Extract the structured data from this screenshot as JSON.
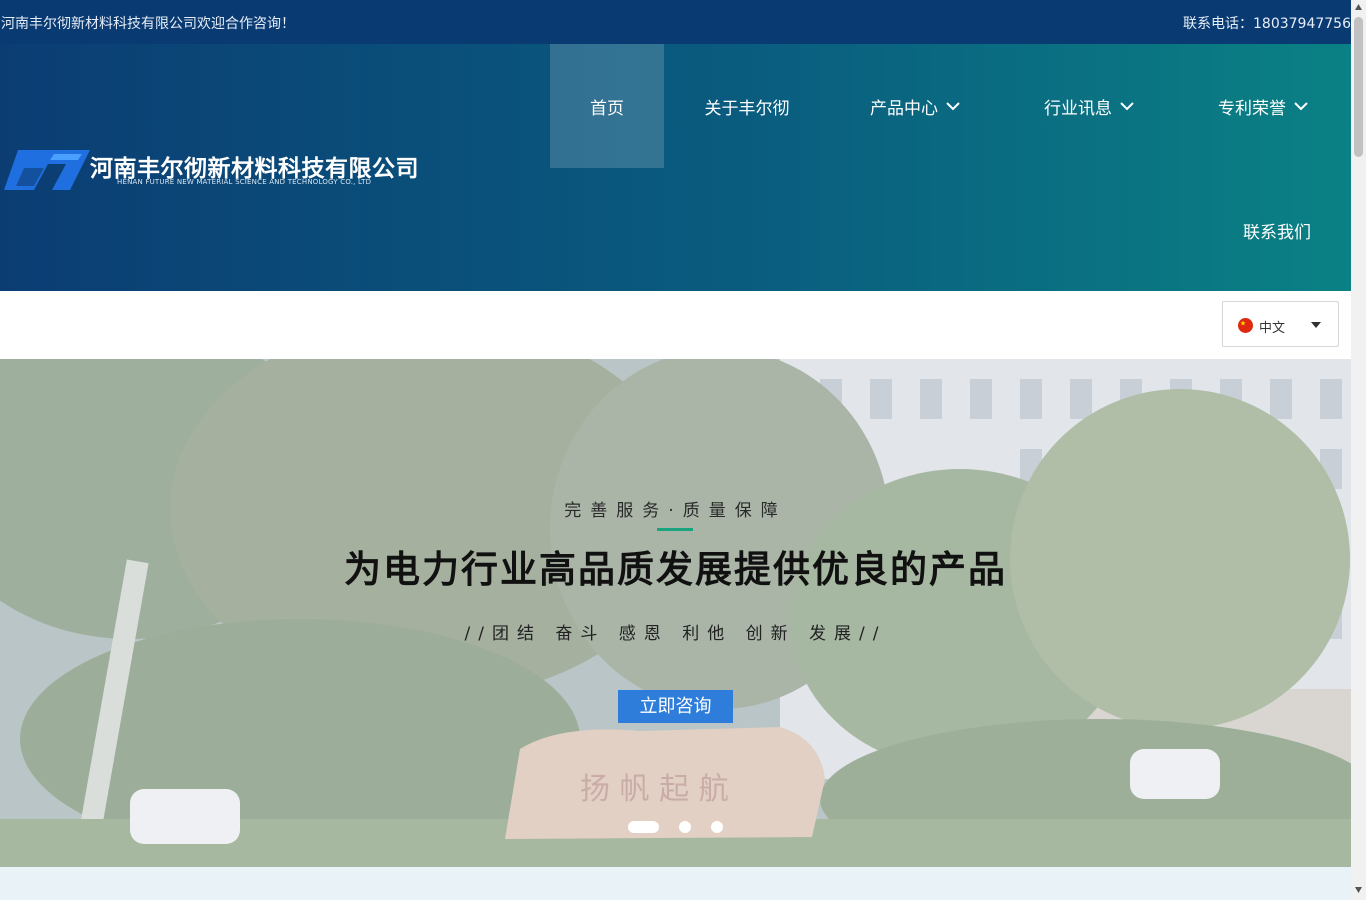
{
  "topbar": {
    "welcome": "河南丰尔彻新材料科技有限公司欢迎合作咨询！",
    "phone": "联系电话：18037947756"
  },
  "logo": {
    "name_cn": "河南丰尔彻新材料科技有限公司",
    "name_en": "HENAN FUTURE NEW MATERIAL SCIENCE AND TECHNOLOGY CO., LTD"
  },
  "nav": {
    "items": [
      {
        "label": "首页",
        "active": true
      },
      {
        "label": "关于丰尔彻"
      },
      {
        "label": "产品中心",
        "dropdown": true
      },
      {
        "label": "行业讯息",
        "dropdown": true
      },
      {
        "label": "专利荣誉",
        "dropdown": true
      },
      {
        "label": "联系我们"
      }
    ]
  },
  "language": {
    "selected": "中文"
  },
  "hero": {
    "subtitle": "完善服务·质量保障",
    "title": "为电力行业高品质发展提供优良的产品",
    "motto": "//团结 奋斗 感恩 利他 创新 发展//",
    "cta": "立即咨询",
    "slides": 3,
    "active_slide": 1
  },
  "colors": {
    "topbar": "#0a3a72",
    "header_start": "#0b3d73",
    "header_end": "#0a8184",
    "accent_line": "#1aa37f",
    "cta": "#2e7ddb",
    "logo_mark": "#1f6fe0"
  }
}
